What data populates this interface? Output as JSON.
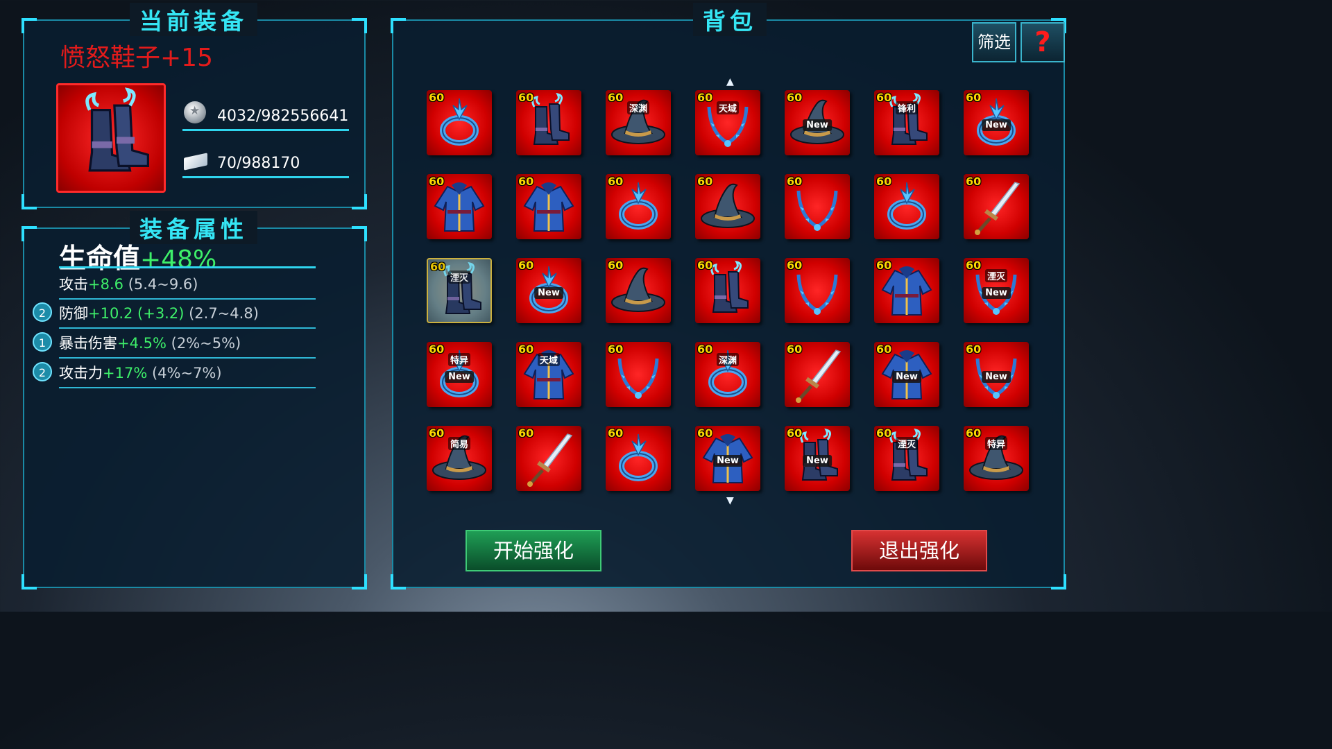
{
  "current_panel": {
    "title": "当前装备",
    "item_name": "愤怒鞋子+15",
    "item_icon": "boots-icon",
    "silver": "4032/982556641",
    "ticket": "70/988170"
  },
  "attr_panel": {
    "title": "装备属性",
    "main": {
      "name": "生命值",
      "value": "+48%"
    },
    "rows": [
      {
        "badge": "",
        "name": "攻击",
        "value": "+8.6",
        "range": "(5.4~9.6)"
      },
      {
        "badge": "2",
        "name": "防御",
        "value": "+10.2 (+3.2)",
        "range": "(2.7~4.8)"
      },
      {
        "badge": "1",
        "name": "暴击伤害",
        "value": "+4.5%",
        "range": "(2%~5%)"
      },
      {
        "badge": "2",
        "name": "攻击力",
        "value": "+17%",
        "range": "(4%~7%)"
      }
    ]
  },
  "bag_panel": {
    "title": "背包",
    "filter_label": "筛选",
    "help_label": "?",
    "up_arrow": "▲",
    "down_arrow": "▼",
    "start_label": "开始强化",
    "exit_label": "退出强化",
    "items": [
      {
        "level": "60",
        "icon": "ring-icon",
        "tag": "",
        "new": ""
      },
      {
        "level": "60",
        "icon": "boots-icon",
        "tag": "",
        "new": ""
      },
      {
        "level": "60",
        "icon": "hat-icon",
        "tag": "深渊",
        "new": ""
      },
      {
        "level": "60",
        "icon": "necklace-icon",
        "tag": "天域",
        "new": ""
      },
      {
        "level": "60",
        "icon": "hat-icon",
        "tag": "",
        "new": "New"
      },
      {
        "level": "60",
        "icon": "boots-icon",
        "tag": "锋利",
        "new": ""
      },
      {
        "level": "60",
        "icon": "ring-icon",
        "tag": "",
        "new": "New"
      },
      {
        "level": "60",
        "icon": "robe-icon",
        "tag": "",
        "new": ""
      },
      {
        "level": "60",
        "icon": "robe-icon",
        "tag": "",
        "new": ""
      },
      {
        "level": "60",
        "icon": "ring-icon",
        "tag": "",
        "new": ""
      },
      {
        "level": "60",
        "icon": "hat-icon",
        "tag": "",
        "new": ""
      },
      {
        "level": "60",
        "icon": "necklace-icon",
        "tag": "",
        "new": ""
      },
      {
        "level": "60",
        "icon": "ring-icon",
        "tag": "",
        "new": ""
      },
      {
        "level": "60",
        "icon": "sword-icon",
        "tag": "",
        "new": ""
      },
      {
        "level": "60",
        "icon": "boots-icon",
        "tag": "湮灭",
        "new": "",
        "selected": true
      },
      {
        "level": "60",
        "icon": "ring-icon",
        "tag": "",
        "new": "New"
      },
      {
        "level": "60",
        "icon": "hat-icon",
        "tag": "",
        "new": ""
      },
      {
        "level": "60",
        "icon": "boots-icon",
        "tag": "",
        "new": ""
      },
      {
        "level": "60",
        "icon": "necklace-icon",
        "tag": "",
        "new": ""
      },
      {
        "level": "60",
        "icon": "robe-icon",
        "tag": "",
        "new": ""
      },
      {
        "level": "60",
        "icon": "necklace-icon",
        "tag": "湮灭",
        "new": "New"
      },
      {
        "level": "60",
        "icon": "ring-icon",
        "tag": "特异",
        "new": "New"
      },
      {
        "level": "60",
        "icon": "robe-icon",
        "tag": "天域",
        "new": ""
      },
      {
        "level": "60",
        "icon": "necklace-icon",
        "tag": "",
        "new": ""
      },
      {
        "level": "60",
        "icon": "ring-icon",
        "tag": "深渊",
        "new": ""
      },
      {
        "level": "60",
        "icon": "sword-icon",
        "tag": "",
        "new": ""
      },
      {
        "level": "60",
        "icon": "robe-icon",
        "tag": "",
        "new": "New"
      },
      {
        "level": "60",
        "icon": "necklace-icon",
        "tag": "",
        "new": "New"
      },
      {
        "level": "60",
        "icon": "hat-icon",
        "tag": "简易",
        "new": ""
      },
      {
        "level": "60",
        "icon": "sword-icon",
        "tag": "",
        "new": ""
      },
      {
        "level": "60",
        "icon": "ring-icon",
        "tag": "",
        "new": ""
      },
      {
        "level": "60",
        "icon": "robe-icon",
        "tag": "",
        "new": "New"
      },
      {
        "level": "60",
        "icon": "boots-icon",
        "tag": "",
        "new": "New"
      },
      {
        "level": "60",
        "icon": "boots-icon",
        "tag": "湮灭",
        "new": ""
      },
      {
        "level": "60",
        "icon": "hat-icon",
        "tag": "特异",
        "new": ""
      }
    ]
  }
}
